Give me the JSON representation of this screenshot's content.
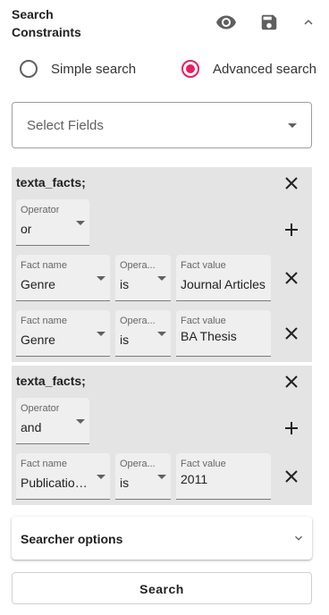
{
  "header": {
    "title_line1": "Search",
    "title_line2": "Constraints",
    "icons": [
      "eye-icon",
      "save-icon",
      "chevron-up-icon"
    ]
  },
  "search_mode": {
    "simple_label": "Simple search",
    "advanced_label": "Advanced search",
    "selected": "advanced",
    "accent_color": "#e91e63"
  },
  "select_fields": {
    "placeholder": "Select Fields"
  },
  "constraints": [
    {
      "title": "texta_facts;",
      "operator_label": "Operator",
      "operator_value": "or",
      "rows": [
        {
          "fact_name_label": "Fact name",
          "fact_name": "Genre",
          "op_label": "Opera...",
          "op_value": "is",
          "fact_value_label": "Fact value",
          "fact_value": "Journal Articles"
        },
        {
          "fact_name_label": "Fact name",
          "fact_name": "Genre",
          "op_label": "Opera...",
          "op_value": "is",
          "fact_value_label": "Fact value",
          "fact_value": "BA Thesis"
        }
      ]
    },
    {
      "title": "texta_facts;",
      "operator_label": "Operator",
      "operator_value": "and",
      "rows": [
        {
          "fact_name_label": "Fact name",
          "fact_name": "Publication ...",
          "op_label": "Opera...",
          "op_value": "is",
          "fact_value_label": "Fact value",
          "fact_value": "2011"
        }
      ]
    }
  ],
  "searcher_options": {
    "label": "Searcher options"
  },
  "search_button": {
    "label": "Search"
  },
  "colors": {
    "panel_bg": "#e4e4e4",
    "field_bg": "#efefef",
    "icon": "#5f5f5f"
  }
}
